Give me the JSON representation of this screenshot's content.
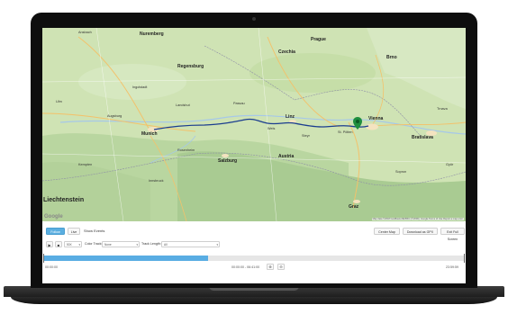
{
  "map": {
    "provider_logo": "Google",
    "attribution": "Map data ©2018 GeoBasis-DE/BKG (©2009), Google  Terms of Use  Report a map error",
    "places": [
      {
        "name": "Ansbach"
      },
      {
        "name": "Nuremberg"
      },
      {
        "name": "Regensburg"
      },
      {
        "name": "Prague"
      },
      {
        "name": "Brno"
      },
      {
        "name": "Ingolstadt"
      },
      {
        "name": "Landshut"
      },
      {
        "name": "Passau"
      },
      {
        "name": "Augsburg"
      },
      {
        "name": "Munich"
      },
      {
        "name": "Rosenheim"
      },
      {
        "name": "Salzburg"
      },
      {
        "name": "Linz"
      },
      {
        "name": "St. Pölten"
      },
      {
        "name": "Vienna"
      },
      {
        "name": "Bratislava"
      },
      {
        "name": "Innsbruck"
      },
      {
        "name": "Graz"
      },
      {
        "name": "Györ"
      },
      {
        "name": "Liechtenstein"
      },
      {
        "name": "Kempten"
      },
      {
        "name": "Ulm"
      },
      {
        "name": "Austria"
      },
      {
        "name": "Wels"
      },
      {
        "name": "Steyr"
      },
      {
        "name": "Trnava"
      },
      {
        "name": "Sopron"
      },
      {
        "name": "Czechia"
      }
    ]
  },
  "toolbar": {
    "follow_label": "Follow",
    "live_label": "Live",
    "show_events_label": "Show Events",
    "center_map_label": "Center Map",
    "download_gpx_label": "Download as GPX",
    "exit_fullscreen_label": "Exit Full Screen"
  },
  "playback": {
    "speed_value": "50X",
    "color_track_label": "Color Track:",
    "color_track_value": "None",
    "track_length_label": "Track Length:",
    "track_length_value": "All"
  },
  "timeline": {
    "start_time": "00:00:00",
    "current_time": "00:00:00 - 06:41:00",
    "end_time": "23:59:59",
    "progress_fraction": 0.39
  },
  "icons": {
    "play": "play-icon",
    "stop": "stop-icon",
    "zoom_in": "zoom-in-icon",
    "zoom_out": "zoom-out-icon",
    "map_pin": "map-pin-icon"
  },
  "colors": {
    "accent": "#59ade3",
    "route": "#1b3d8f",
    "pin": "#1e8e3e"
  }
}
